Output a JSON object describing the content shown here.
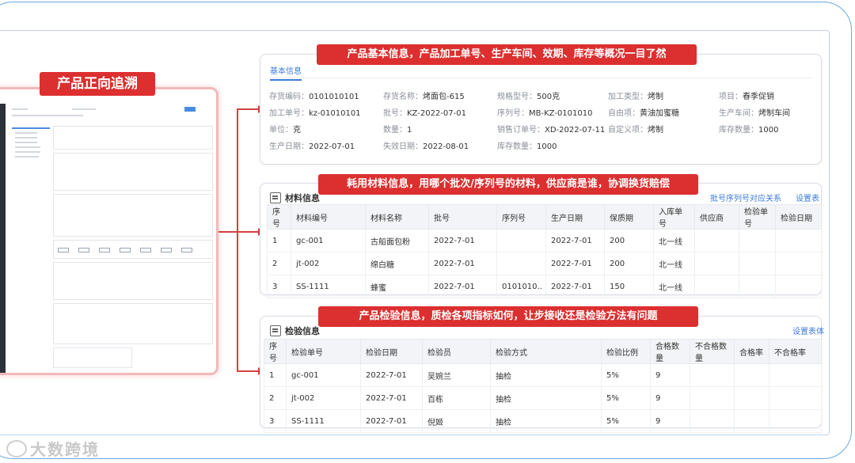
{
  "thumbnail": {
    "title": "产品正向追溯"
  },
  "banners": {
    "basic": "产品基本信息，产品加工单号、生产车间、效期、库存等概况一目了然",
    "materials": "耗用材料信息，用哪个批次/序列号的材料，供应商是谁，协调换货赔偿",
    "inspection": "产品检验信息，质检各项指标如何，让步接收还是检验方法有问题"
  },
  "basic_info": {
    "tab": "基本信息",
    "fields": [
      {
        "k": "存货编码：",
        "v": "0101010101"
      },
      {
        "k": "存货名称：",
        "v": "烤面包-615"
      },
      {
        "k": "规格型号：",
        "v": "500克"
      },
      {
        "k": "加工类型：",
        "v": "烤制"
      },
      {
        "k": "项目：",
        "v": "春季促销"
      },
      {
        "k": "加工单号：",
        "v": "kz-01010101"
      },
      {
        "k": "批号：",
        "v": "KZ-2022-07-01"
      },
      {
        "k": "序列号：",
        "v": "MB-KZ-0101010"
      },
      {
        "k": "自由项：",
        "v": "黄油加蜜糖"
      },
      {
        "k": "生产车间：",
        "v": "烤制车间"
      },
      {
        "k": "单位：",
        "v": "克"
      },
      {
        "k": "数量：",
        "v": "1"
      },
      {
        "k": "销售订单号：",
        "v": "XD-2022-07-11"
      },
      {
        "k": "自定义项：",
        "v": "烤制"
      },
      {
        "k": "库存数量：",
        "v": "1000"
      },
      {
        "k": "生产日期：",
        "v": "2022-07-01"
      },
      {
        "k": "失效日期：",
        "v": "2022-08-01"
      },
      {
        "k": "库存数量：",
        "v": "1000"
      }
    ]
  },
  "materials": {
    "title": "材料信息",
    "link_map": "批号序列号对应关系",
    "link_settings": "设置表",
    "columns": [
      "序号",
      "材料编号",
      "材料名称",
      "批号",
      "序列号",
      "生产日期",
      "保质期",
      "入库单号",
      "供应商",
      "检验单号",
      "检验日期"
    ],
    "rows": [
      [
        "1",
        "gc-001",
        "古船面包粉",
        "2022-7-01",
        "",
        "2022-7-01",
        "200",
        "北一线",
        "",
        "",
        ""
      ],
      [
        "2",
        "jt-002",
        "绵白糖",
        "2022-7-01",
        "",
        "2022-7-01",
        "200",
        "北一线",
        "",
        "",
        ""
      ],
      [
        "3",
        "SS-1111",
        "蜂蜜",
        "2022-7-01",
        "0101010..",
        "2022-7-01",
        "150",
        "北一线",
        "",
        "",
        ""
      ]
    ]
  },
  "inspection": {
    "title": "检验信息",
    "link_settings": "设置表体",
    "columns": [
      "序号",
      "检验单号",
      "检验日期",
      "检验员",
      "检验方式",
      "检验比例",
      "合格数量",
      "不合格数量",
      "合格率",
      "不合格率"
    ],
    "rows": [
      [
        "1",
        "gc-001",
        "2022-7-01",
        "吴婉兰",
        "抽检",
        "5%",
        "9",
        "",
        "",
        ""
      ],
      [
        "2",
        "jt-002",
        "2022-7-01",
        "百栋",
        "抽检",
        "5%",
        "9",
        "",
        "",
        ""
      ],
      [
        "3",
        "SS-1111",
        "2022-7-01",
        "倪姬",
        "抽检",
        "5%",
        "9",
        "",
        "",
        ""
      ]
    ]
  },
  "watermark": "大数跨境",
  "colors": {
    "accent_red": "#dc2f2f",
    "link_blue": "#3b7bd8",
    "frame_blue": "#6aa7e0"
  }
}
